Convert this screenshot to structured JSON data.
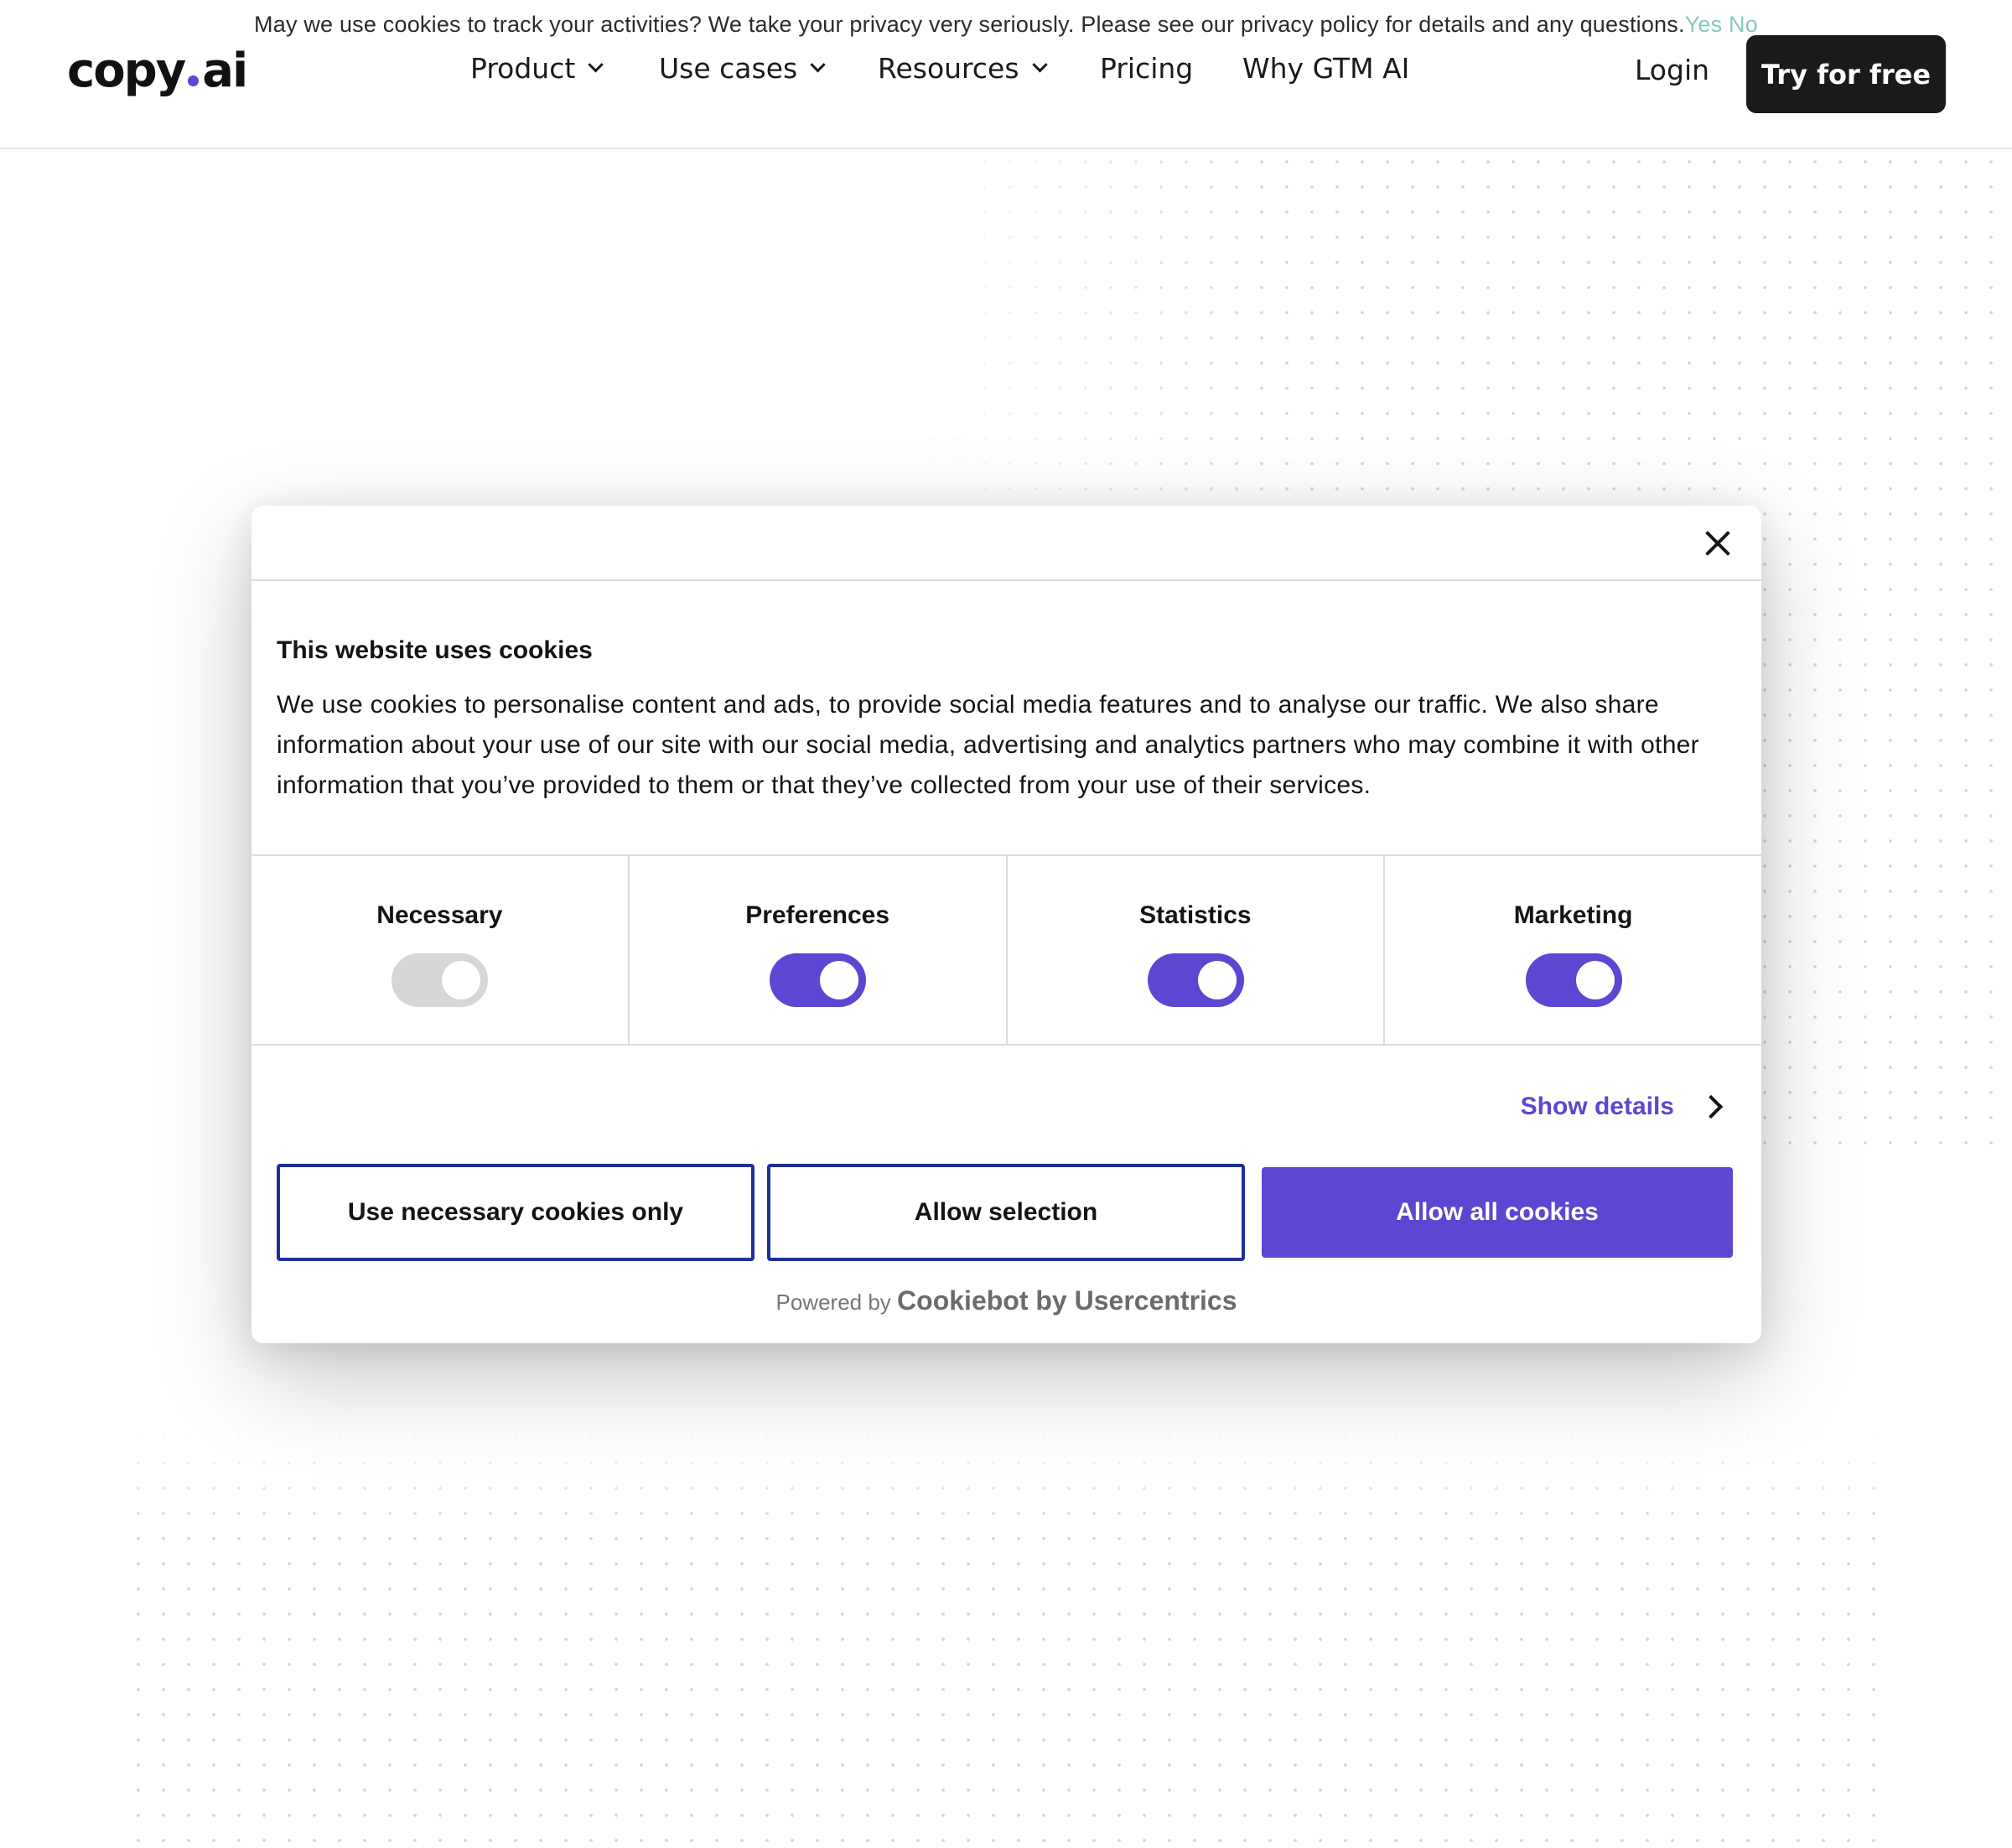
{
  "notice": {
    "text": "May we use cookies to track your activities? We take your privacy very seriously. Please see our privacy policy for details and any questions.",
    "yes_label": "Yes",
    "no_label": "No",
    "link_color": "#86c8be"
  },
  "header": {
    "logo_left": "copy",
    "logo_right": "ai",
    "nav": [
      {
        "label": "Product",
        "icon": "chevron-down-icon"
      },
      {
        "label": "Use cases",
        "icon": "chevron-down-icon"
      },
      {
        "label": "Resources",
        "icon": "chevron-down-icon"
      },
      {
        "label": "Pricing"
      },
      {
        "label": "Why GTM AI"
      }
    ],
    "login_label": "Login",
    "cta_label": "Try for free"
  },
  "dialog": {
    "close_icon": "close-icon",
    "title": "This website uses cookies",
    "body": "We use cookies to personalise content and ads, to provide social media features and to analyse our traffic. We also share information about your use of our site with our social media, advertising and analytics partners who may combine it with other information that you’ve provided to them or that they’ve collected from your use of their services.",
    "toggles": [
      {
        "label": "Necessary",
        "checked": true,
        "disabled": true
      },
      {
        "label": "Preferences",
        "checked": true,
        "disabled": false
      },
      {
        "label": "Statistics",
        "checked": true,
        "disabled": false
      },
      {
        "label": "Marketing",
        "checked": true,
        "disabled": false
      }
    ],
    "show_details_label": "Show details",
    "buttons": {
      "necessary_only": "Use necessary cookies only",
      "allow_selection": "Allow selection",
      "allow_all": "Allow all cookies"
    },
    "powered_by_prefix": "Powered by",
    "powered_by_brand": "Cookiebot by Usercentrics"
  },
  "colors": {
    "accent": "#5d46d1",
    "outline_button_border": "#1f2f9a",
    "cta_background": "#1a1a1a"
  }
}
